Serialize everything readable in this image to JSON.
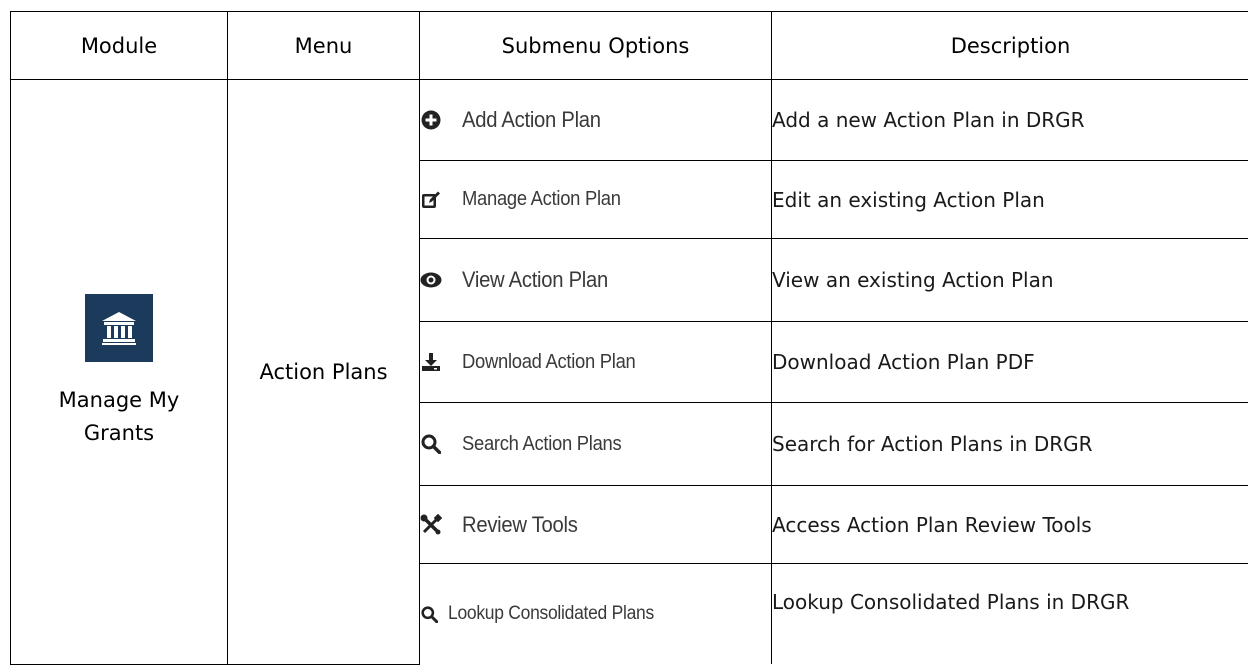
{
  "headers": {
    "module": "Module",
    "menu": "Menu",
    "submenu": "Submenu Options",
    "description": "Description"
  },
  "module": {
    "label": "Manage My Grants",
    "icon": "bank-icon",
    "icon_bg": "#1b3a5c"
  },
  "menu": {
    "label": "Action Plans"
  },
  "rows": [
    {
      "icon": "plus-circle-icon",
      "label": "Add Action Plan",
      "description": "Add a new Action Plan in DRGR"
    },
    {
      "icon": "edit-icon",
      "label": "Manage Action Plan",
      "description": "Edit an existing Action Plan"
    },
    {
      "icon": "eye-icon",
      "label": "View Action Plan",
      "description": "View an existing Action Plan"
    },
    {
      "icon": "download-icon",
      "label": "Download Action Plan",
      "description": "Download Action Plan PDF"
    },
    {
      "icon": "search-icon",
      "label": "Search Action Plans",
      "description": "Search for Action Plans in DRGR"
    },
    {
      "icon": "wrench-screwdriver-icon",
      "label": "Review Tools",
      "description": "Access Action Plan Review Tools"
    },
    {
      "icon": "search-icon",
      "label": "Lookup Consolidated Plans",
      "description": "Lookup Consolidated Plans in DRGR"
    }
  ]
}
